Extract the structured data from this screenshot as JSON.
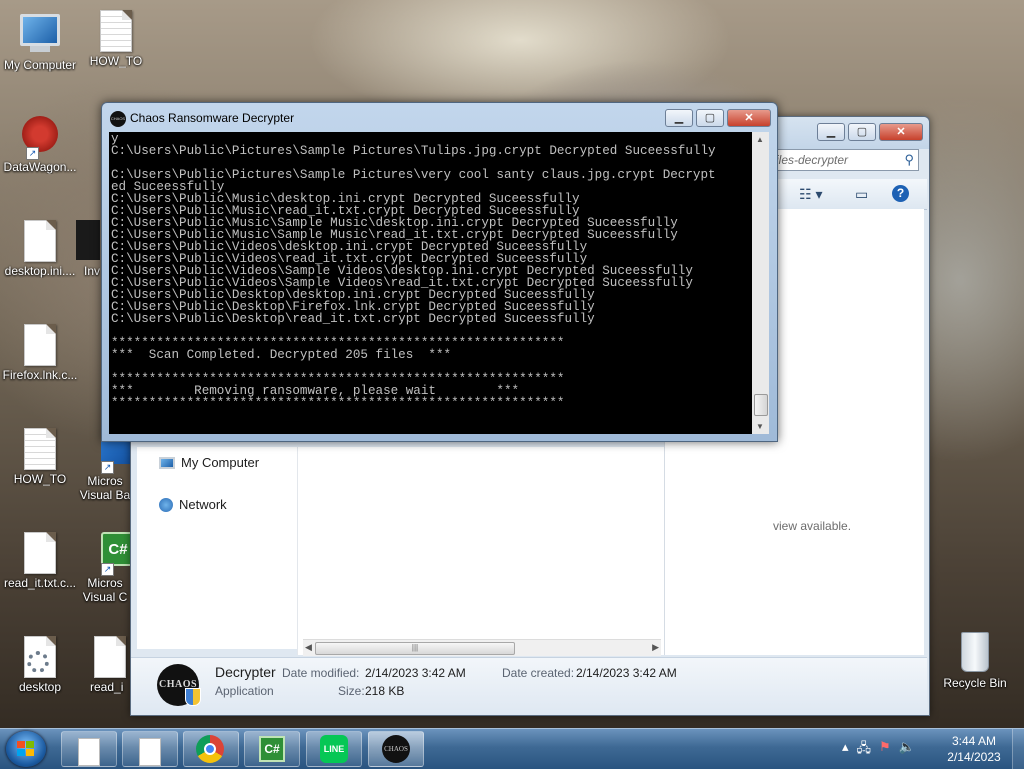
{
  "desktop": {
    "icons": [
      {
        "label": "My Computer"
      },
      {
        "label": "HOW_TO"
      },
      {
        "label": "DataWagon..."
      },
      {
        "label": "desktop.ini...."
      },
      {
        "label": "Inv"
      },
      {
        "label": "Firefox.lnk.c..."
      },
      {
        "label": "HOW_TO"
      },
      {
        "label": "Micros Visual Ba"
      },
      {
        "label": "read_it.txt.c..."
      },
      {
        "label": "Micros Visual C"
      },
      {
        "label": "desktop"
      },
      {
        "label": "read_i"
      },
      {
        "label": "Recycle Bin"
      }
    ]
  },
  "explorer": {
    "search_placeholder": "iles-decrypter",
    "preview_text": "view available.",
    "nav": [
      {
        "label": "My Computer"
      },
      {
        "label": "Network"
      }
    ],
    "details": {
      "name": "Decrypter",
      "type": "Application",
      "date_modified_label": "Date modified:",
      "date_modified": "2/14/2023 3:42 AM",
      "date_created_label": "Date created:",
      "date_created": "2/14/2023 3:42 AM",
      "size_label": "Size:",
      "size": "218 KB",
      "logo_text": "CHAOS"
    }
  },
  "console": {
    "title": "Chaos Ransomware Decrypter",
    "lines": [
      "y",
      "C:\\Users\\Public\\Pictures\\Sample Pictures\\Tulips.jpg.crypt Decrypted Suceessfully",
      "",
      "C:\\Users\\Public\\Pictures\\Sample Pictures\\very cool santy claus.jpg.crypt Decrypt",
      "ed Suceessfully",
      "C:\\Users\\Public\\Music\\desktop.ini.crypt Decrypted Suceessfully",
      "C:\\Users\\Public\\Music\\read_it.txt.crypt Decrypted Suceessfully",
      "C:\\Users\\Public\\Music\\Sample Music\\desktop.ini.crypt Decrypted Suceessfully",
      "C:\\Users\\Public\\Music\\Sample Music\\read_it.txt.crypt Decrypted Suceessfully",
      "C:\\Users\\Public\\Videos\\desktop.ini.crypt Decrypted Suceessfully",
      "C:\\Users\\Public\\Videos\\read_it.txt.crypt Decrypted Suceessfully",
      "C:\\Users\\Public\\Videos\\Sample Videos\\desktop.ini.crypt Decrypted Suceessfully",
      "C:\\Users\\Public\\Videos\\Sample Videos\\read_it.txt.crypt Decrypted Suceessfully",
      "C:\\Users\\Public\\Desktop\\desktop.ini.crypt Decrypted Suceessfully",
      "C:\\Users\\Public\\Desktop\\Firefox.lnk.crypt Decrypted Suceessfully",
      "C:\\Users\\Public\\Desktop\\read_it.txt.crypt Decrypted Suceessfully",
      "",
      "************************************************************",
      "***  Scan Completed. Decrypted 205 files  ***",
      "",
      "************************************************************",
      "***        Removing ransomware, please wait        ***",
      "************************************************************"
    ]
  },
  "taskbar": {
    "buttons": [
      {
        "icon": "file-icon"
      },
      {
        "icon": "file-icon"
      },
      {
        "icon": "chrome-icon"
      },
      {
        "icon": "csharp-icon",
        "label": "C#"
      },
      {
        "icon": "line-icon",
        "label": "LINE"
      },
      {
        "icon": "chaos-icon",
        "label": "CHAOS"
      }
    ],
    "clock_time": "3:44 AM",
    "clock_date": "2/14/2023"
  },
  "colors": {
    "console_bg": "#000000",
    "console_fg": "#c0c0c0",
    "taskbar": "#3e6994",
    "close_button": "#c7412c"
  }
}
